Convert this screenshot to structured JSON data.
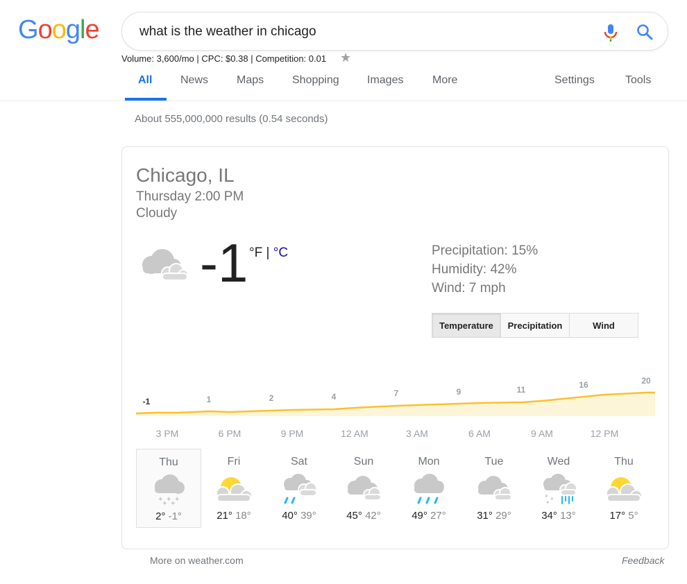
{
  "logo": [
    "G",
    "o",
    "o",
    "g",
    "l",
    "e"
  ],
  "search": {
    "query": "what is the weather in chicago"
  },
  "keyword_info": "Volume: 3,600/mo | CPC: $0.38 | Competition: 0.01",
  "tabs": [
    {
      "label": "All",
      "active": true
    },
    {
      "label": "News"
    },
    {
      "label": "Maps"
    },
    {
      "label": "Shopping"
    },
    {
      "label": "Images"
    },
    {
      "label": "More"
    },
    {
      "label": "Settings"
    },
    {
      "label": "Tools"
    }
  ],
  "result_stats": "About 555,000,000 results (0.54 seconds)",
  "weather": {
    "location": "Chicago, IL",
    "time": "Thursday 2:00 PM",
    "condition": "Cloudy",
    "temperature": "-1",
    "unit_f": "°F",
    "unit_sep": " | ",
    "unit_c": "°C",
    "precipitation": "Precipitation: 15%",
    "humidity": "Humidity: 42%",
    "wind": "Wind: 7 mph",
    "buttons": [
      "Temperature",
      "Precipitation",
      "Wind"
    ],
    "hourly_temps": [
      "-1",
      "1",
      "2",
      "4",
      "7",
      "9",
      "11",
      "16",
      "20"
    ],
    "hours": [
      "3 PM",
      "6 PM",
      "9 PM",
      "12 AM",
      "3 AM",
      "6 AM",
      "9 AM",
      "12 PM"
    ],
    "days": [
      {
        "name": "Thu",
        "hi": "2°",
        "lo": "-1°",
        "icon": "snow-icon"
      },
      {
        "name": "Fri",
        "hi": "21°",
        "lo": "18°",
        "icon": "partly-cloudy-icon"
      },
      {
        "name": "Sat",
        "hi": "40°",
        "lo": "39°",
        "icon": "rain-icon"
      },
      {
        "name": "Sun",
        "hi": "45°",
        "lo": "42°",
        "icon": "cloudy-icon"
      },
      {
        "name": "Mon",
        "hi": "49°",
        "lo": "27°",
        "icon": "showers-icon"
      },
      {
        "name": "Tue",
        "hi": "31°",
        "lo": "29°",
        "icon": "cloudy-icon"
      },
      {
        "name": "Wed",
        "hi": "34°",
        "lo": "13°",
        "icon": "rain-snow-icon"
      },
      {
        "name": "Thu",
        "hi": "17°",
        "lo": "5°",
        "icon": "partly-cloudy-icon"
      }
    ]
  },
  "footer": {
    "more": "More on weather.com",
    "feedback": "Feedback"
  },
  "colors": {
    "blue": "#4285f4",
    "red": "#ea4335",
    "yellow": "#fbbc05",
    "green": "#34a853",
    "line": "#fbc02d",
    "fill": "#fdf5d8"
  }
}
